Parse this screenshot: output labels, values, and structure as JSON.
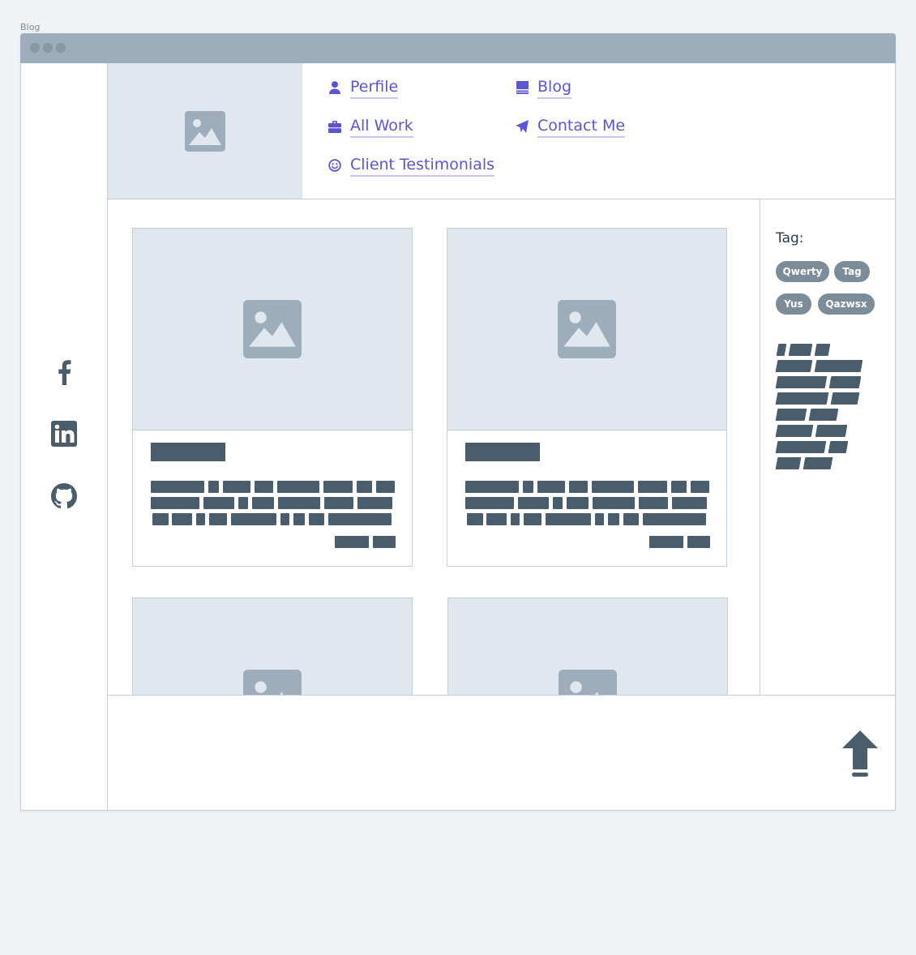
{
  "caption": "Blog",
  "colors": {
    "accent": "#5a55d8",
    "placeholder_bg": "#e1e7ef",
    "ink": "#4a5d6d",
    "tag_bg": "#7d8c99"
  },
  "social": [
    {
      "name": "facebook",
      "icon": "facebook-icon"
    },
    {
      "name": "linkedin",
      "icon": "linkedin-icon"
    },
    {
      "name": "github",
      "icon": "github-icon"
    }
  ],
  "nav": {
    "profile": {
      "label": "Perfile",
      "icon": "user-icon"
    },
    "blog": {
      "label": "Blog",
      "icon": "book-icon"
    },
    "work": {
      "label": "All Work",
      "icon": "briefcase-icon"
    },
    "contact": {
      "label": "Contact Me",
      "icon": "paper-plane-icon"
    },
    "testimonials": {
      "label": "Client Testimonials",
      "icon": "smile-icon"
    }
  },
  "sidebar": {
    "tag_heading": "Tag:",
    "tags": [
      "Qwerty",
      "Tag",
      "Yus",
      "Qazwsx"
    ]
  },
  "footer": {
    "scroll_top_icon": "arrow-up-icon"
  }
}
